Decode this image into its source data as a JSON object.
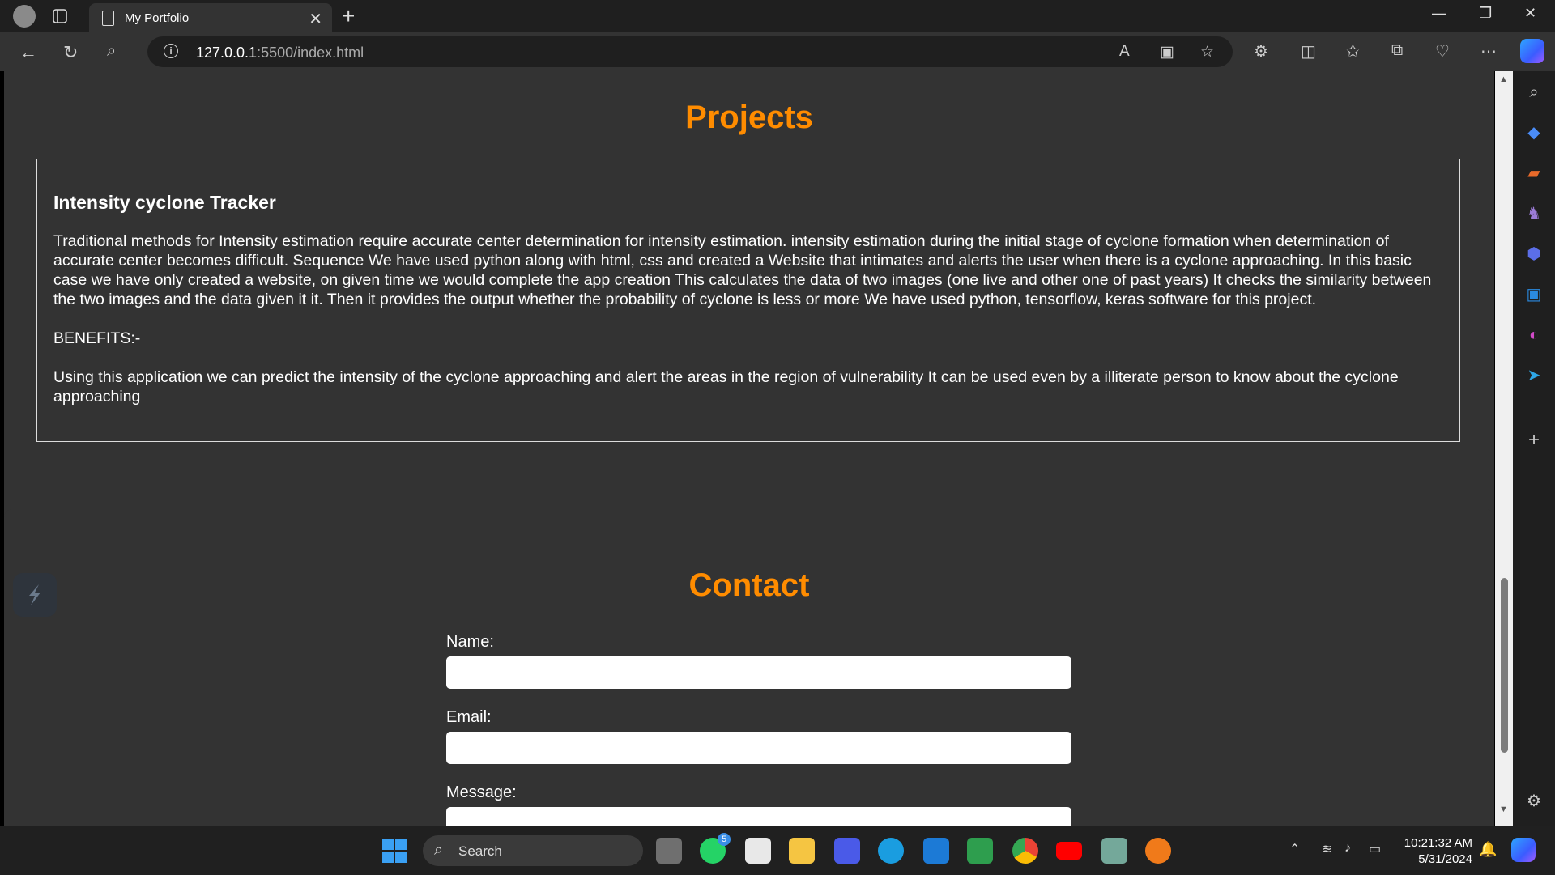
{
  "browser": {
    "tab_title": "My Portfolio",
    "url_host": "127.0.0.1",
    "url_path": ":5500/index.html"
  },
  "page": {
    "projects": {
      "heading": "Projects",
      "card_title": "Intensity cyclone Tracker",
      "description": "Traditional methods for Intensity estimation require accurate center determination for intensity estimation. intensity estimation during the initial stage of cyclone formation when determination of accurate center becomes difficult. Sequence We have used python along with html, css and created a Website that intimates and alerts the user when there is a cyclone approaching. In this basic case we have only created a website, on given time we would complete the app creation This calculates the data of two images (one live and other one of past years) It checks the similarity between the two images and the data given it it. Then it provides the output whether the probability of cyclone is less or more We have used python, tensorflow, keras software for this project.",
      "benefits_label": "BENEFITS:-",
      "benefits_text": "Using this application we can predict the intensity of the cyclone approaching and alert the areas in the region of vulnerability It can be used even by a illiterate person to know about the cyclone approaching"
    },
    "contact": {
      "heading": "Contact",
      "name_label": "Name:",
      "email_label": "Email:",
      "message_label": "Message:",
      "name_value": "",
      "email_value": "",
      "message_value": ""
    }
  },
  "taskbar": {
    "search_label": "Search",
    "whatsapp_badge": "5",
    "time": "10:21:32 AM",
    "date": "5/31/2024"
  },
  "colors": {
    "accent": "#ff8c00",
    "section_bg": "#333333",
    "page_bg": "#000000"
  },
  "icons": {
    "toolbar": [
      "back-icon",
      "refresh-icon",
      "search-icon",
      "info-icon",
      "read-aloud-icon",
      "immersive-reader-icon",
      "favorite-star-icon",
      "extensions-icon",
      "split-screen-icon",
      "favorites-icon",
      "collections-icon",
      "browser-essentials-icon",
      "more-icon",
      "copilot-icon"
    ],
    "sidebar": [
      "sidebar-search-icon",
      "shopping-icon",
      "tools-icon",
      "games-icon",
      "microsoft365-icon",
      "outlook-icon",
      "designer-icon",
      "telegram-icon",
      "add-icon",
      "settings-icon"
    ]
  }
}
